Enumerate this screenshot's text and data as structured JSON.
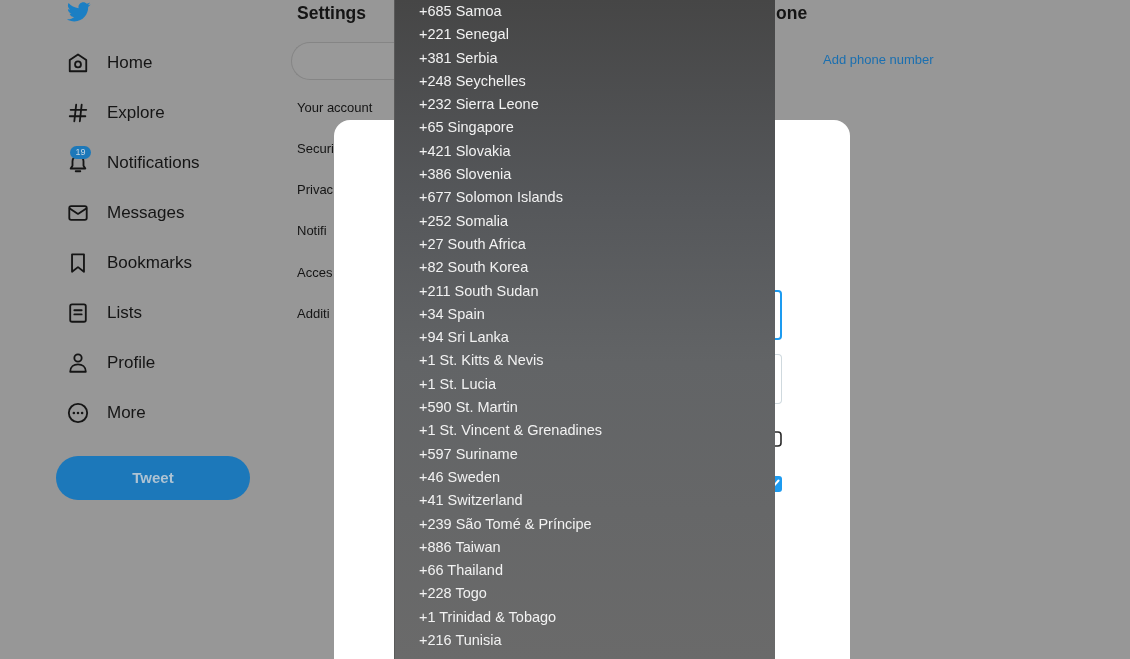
{
  "sidebar": {
    "items": [
      {
        "label": "Home",
        "selected": false
      },
      {
        "label": "Explore",
        "selected": false
      },
      {
        "label": "Notifications",
        "selected": false,
        "badge": "19"
      },
      {
        "label": "Messages",
        "selected": false
      },
      {
        "label": "Bookmarks",
        "selected": false
      },
      {
        "label": "Lists",
        "selected": false
      },
      {
        "label": "Profile",
        "selected": false
      },
      {
        "label": "More",
        "selected": false
      }
    ],
    "tweet_button": "Tweet"
  },
  "settings": {
    "title": "Settings",
    "menu": [
      {
        "label": "Your account",
        "selected": false
      },
      {
        "label": "Securi",
        "selected": false
      },
      {
        "label": "Privac",
        "selected": false
      },
      {
        "label": "Notifi",
        "selected": false
      },
      {
        "label": "Acces",
        "selected": false
      },
      {
        "label": "Additi",
        "selected": false
      }
    ]
  },
  "phone_panel": {
    "heading": "one",
    "link": "Add phone number"
  },
  "dialog": {
    "fields": [
      {
        "focused": true
      },
      {
        "focused": false
      }
    ],
    "checkboxes": [
      {
        "checked": false
      },
      {
        "checked": true
      }
    ]
  },
  "country_menu": {
    "options": [
      {
        "label": "+685 Samoa",
        "selected": false
      },
      {
        "label": "+221 Senegal",
        "selected": false
      },
      {
        "label": "+381 Serbia",
        "selected": false
      },
      {
        "label": "+248 Seychelles",
        "selected": false
      },
      {
        "label": "+232 Sierra Leone",
        "selected": false
      },
      {
        "label": "+65 Singapore",
        "selected": false
      },
      {
        "label": "+421 Slovakia",
        "selected": false
      },
      {
        "label": "+386 Slovenia",
        "selected": false
      },
      {
        "label": "+677 Solomon Islands",
        "selected": false
      },
      {
        "label": "+252 Somalia",
        "selected": false
      },
      {
        "label": "+27 South Africa",
        "selected": false
      },
      {
        "label": "+82 South Korea",
        "selected": false
      },
      {
        "label": "+211 South Sudan",
        "selected": false
      },
      {
        "label": "+34 Spain",
        "selected": false
      },
      {
        "label": "+94 Sri Lanka",
        "selected": false
      },
      {
        "label": "+1 St. Kitts & Nevis",
        "selected": false
      },
      {
        "label": "+1 St. Lucia",
        "selected": false
      },
      {
        "label": "+590 St. Martin",
        "selected": false
      },
      {
        "label": "+1 St. Vincent & Grenadines",
        "selected": false
      },
      {
        "label": "+597 Suriname",
        "selected": false
      },
      {
        "label": "+46 Sweden",
        "selected": false
      },
      {
        "label": "+41 Switzerland",
        "selected": false
      },
      {
        "label": "+239 São Tomé & Príncipe",
        "selected": false
      },
      {
        "label": "+886 Taiwan",
        "selected": false
      },
      {
        "label": "+66 Thailand",
        "selected": false
      },
      {
        "label": "+228 Togo",
        "selected": false
      },
      {
        "label": "+1 Trinidad & Tobago",
        "selected": false
      },
      {
        "label": "+216 Tunisia",
        "selected": false
      }
    ]
  }
}
